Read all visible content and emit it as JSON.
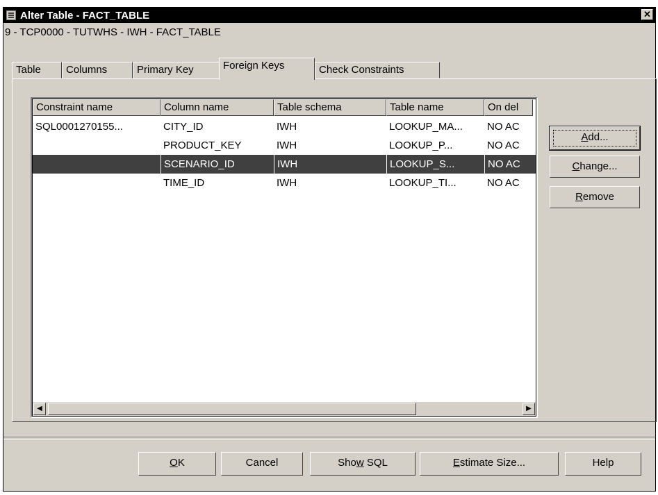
{
  "window": {
    "title": "Alter Table - FACT_TABLE",
    "close_glyph": "✕",
    "path": "9 - TCP0000 - TUTWHS - IWH - FACT_TABLE"
  },
  "tabs": [
    {
      "label": "Table",
      "active": false
    },
    {
      "label": "Columns",
      "active": false
    },
    {
      "label": "Primary Key",
      "active": false
    },
    {
      "label": "Foreign Keys",
      "active": true
    },
    {
      "label": "Check Constraints",
      "active": false
    }
  ],
  "table": {
    "columns": [
      "Constraint name",
      "Column name",
      "Table schema",
      "Table name",
      "On del"
    ],
    "rows": [
      [
        "SQL0001270155...",
        "CITY_ID",
        "IWH",
        "LOOKUP_MA...",
        "NO AC"
      ],
      [
        "",
        "PRODUCT_KEY",
        "IWH",
        "LOOKUP_P...",
        "NO AC"
      ],
      [
        "",
        "SCENARIO_ID",
        "IWH",
        "LOOKUP_S...",
        "NO AC"
      ],
      [
        "",
        "TIME_ID",
        "IWH",
        "LOOKUP_TI...",
        "NO AC"
      ]
    ],
    "selected_row": 2,
    "scroll_left_glyph": "◀",
    "scroll_right_glyph": "▶"
  },
  "side_buttons": {
    "add": {
      "prefix": "",
      "mnemonic": "A",
      "rest": "dd..."
    },
    "change": {
      "prefix": "",
      "mnemonic": "C",
      "rest": "hange..."
    },
    "remove": {
      "prefix": "",
      "mnemonic": "R",
      "rest": "emove"
    }
  },
  "bottom_buttons": {
    "ok": {
      "prefix": "",
      "mnemonic": "O",
      "rest": "K"
    },
    "cancel": {
      "label": "Cancel"
    },
    "show_sql": {
      "prefix": "Sho",
      "mnemonic": "w",
      "rest": " SQL"
    },
    "estimate_size": {
      "prefix": "",
      "mnemonic": "E",
      "rest": "stimate Size..."
    },
    "help": {
      "label": "Help"
    }
  },
  "colors": {
    "dialog_bg": "#d4d0c8",
    "title_bg": "#000000",
    "selection_bg": "#404040"
  }
}
